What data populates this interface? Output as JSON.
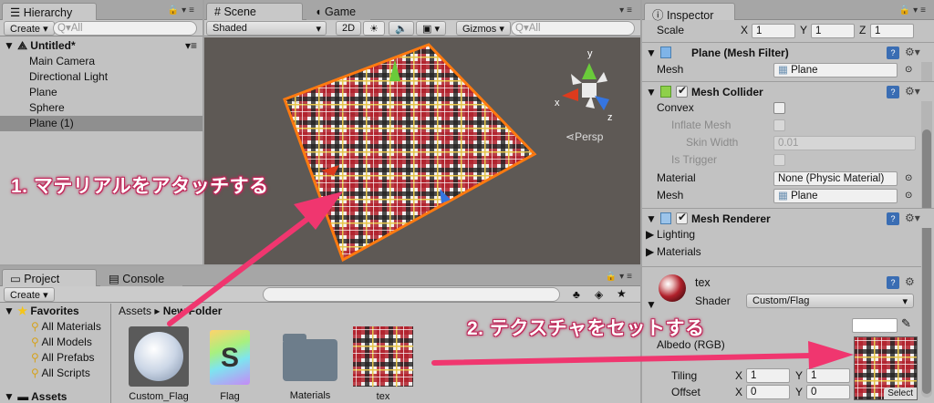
{
  "hierarchy": {
    "tab": "Hierarchy",
    "create": "Create",
    "search_placeholder": "Q▾All",
    "scene_name": "Untitled*",
    "items": [
      "Main Camera",
      "Directional Light",
      "Plane",
      "Sphere",
      "Plane (1)"
    ]
  },
  "scene": {
    "tab_scene": "Scene",
    "tab_game": "Game",
    "shading": "Shaded",
    "mode_2d": "2D",
    "gizmos": "Gizmos",
    "search_placeholder": "Q▾All",
    "persp": "Persp",
    "axis_x": "x",
    "axis_y": "y",
    "axis_z": "z"
  },
  "inspector": {
    "tab": "Inspector",
    "scale_label": "Scale",
    "scale": {
      "x": "1",
      "y": "1",
      "z": "1"
    },
    "mesh_filter": {
      "title": "Plane (Mesh Filter)",
      "mesh_label": "Mesh",
      "mesh_value": "Plane"
    },
    "mesh_collider": {
      "title": "Mesh Collider",
      "convex": "Convex",
      "inflate": "Inflate Mesh",
      "skin_width": "Skin Width",
      "skin_value": "0.01",
      "is_trigger": "Is Trigger",
      "material_label": "Material",
      "material_value": "None (Physic Material)",
      "mesh_label": "Mesh",
      "mesh_value": "Plane"
    },
    "mesh_renderer": {
      "title": "Mesh Renderer",
      "lighting": "Lighting",
      "materials": "Materials"
    },
    "material": {
      "name": "tex",
      "shader_label": "Shader",
      "shader_value": "Custom/Flag",
      "albedo": "Albedo (RGB)",
      "tiling": "Tiling",
      "offset": "Offset",
      "tiling_x": "1",
      "tiling_y": "1",
      "offset_x": "0",
      "offset_y": "0",
      "x": "X",
      "y": "Y",
      "select": "Select"
    }
  },
  "project": {
    "tab_project": "Project",
    "tab_console": "Console",
    "create": "Create",
    "favorites": "Favorites",
    "fav_items": [
      "All Materials",
      "All Models",
      "All Prefabs",
      "All Scripts"
    ],
    "assets_root": "Assets",
    "breadcrumb_root": "Assets",
    "breadcrumb_folder": "New Folder",
    "assets": [
      "Custom_Flag",
      "Flag",
      "Materials",
      "tex"
    ]
  },
  "annotations": {
    "step1": "1. マテリアルをアタッチする",
    "step2": "2. テクスチャをセットする",
    "color": "#f0366f"
  }
}
